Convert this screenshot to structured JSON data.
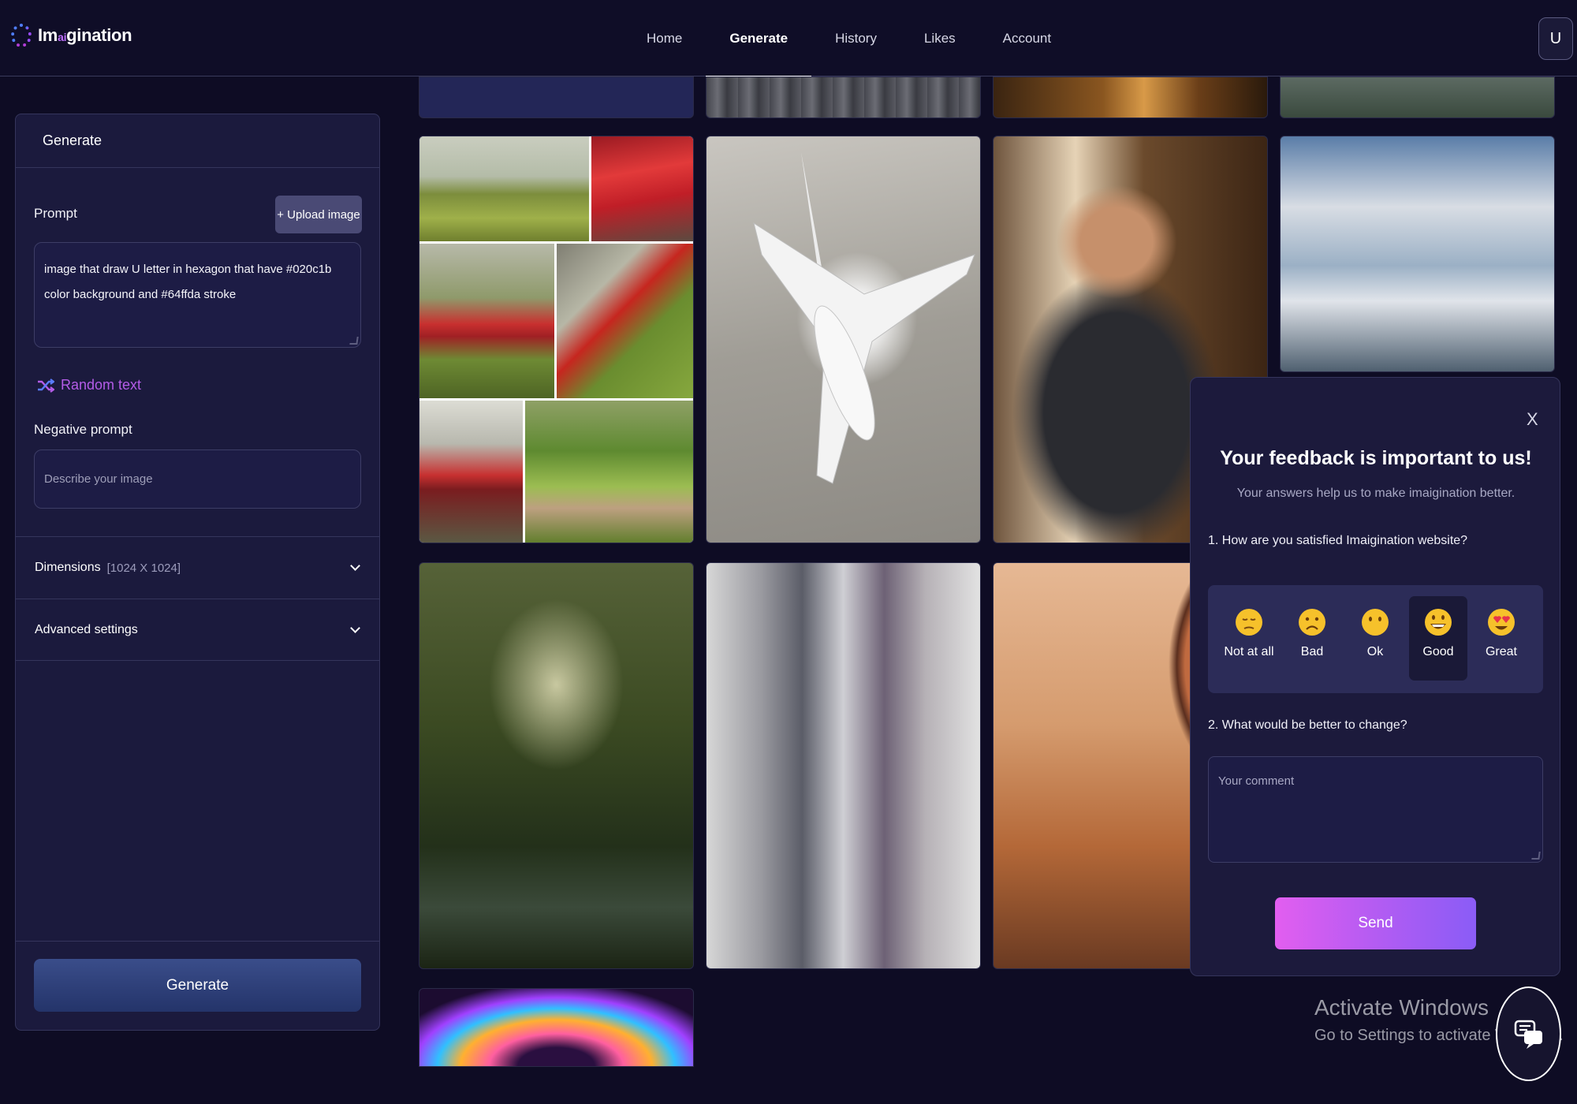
{
  "brand": {
    "name_prefix": "Im",
    "name_ai": "ai",
    "name_suffix": "gination"
  },
  "nav": {
    "items": [
      "Home",
      "Generate",
      "History",
      "Likes",
      "Account"
    ],
    "active": "Generate"
  },
  "user": {
    "initial": "U"
  },
  "panel": {
    "title": "Generate",
    "prompt_label": "Prompt",
    "upload_label": "+ Upload image",
    "prompt_value": "image that draw U letter  in hexagon that have  #020c1b color background and #64ffda stroke",
    "random_text": "Random text",
    "negative_label": "Negative prompt",
    "negative_placeholder": "Describe your image",
    "dimensions_label": "Dimensions",
    "dimensions_value": "[1024 X 1024]",
    "advanced_label": "Advanced settings",
    "generate_button": "Generate"
  },
  "feedback": {
    "close": "X",
    "title": "Your feedback is important to us!",
    "subtitle": "Your answers help us to make imaigination better.",
    "question1": "1. How are you satisfied Imaigination website?",
    "ratings": [
      "Not at all",
      "Bad",
      "Ok",
      "Good",
      "Great"
    ],
    "selected_rating": "Good",
    "question2": "2. What would be better to change?",
    "comment_placeholder": "Your comment",
    "send_button": "Send"
  },
  "watermark": {
    "title": "Activate Windows",
    "subtitle": "Go to Settings to activate Windows."
  },
  "icons": {
    "brand": "logo-ring-icon",
    "random": "shuffle-icon",
    "expand": "chevron-down-icon",
    "chat": "chat-support-icon"
  },
  "colors": {
    "background": "#0e0c24",
    "panel": "#1b1a3d",
    "accent_purple": "#b45ce8",
    "send_gradient_start": "#e25ef0",
    "send_gradient_end": "#8a5cf6",
    "emoji_yellow": "#f6c12b"
  }
}
